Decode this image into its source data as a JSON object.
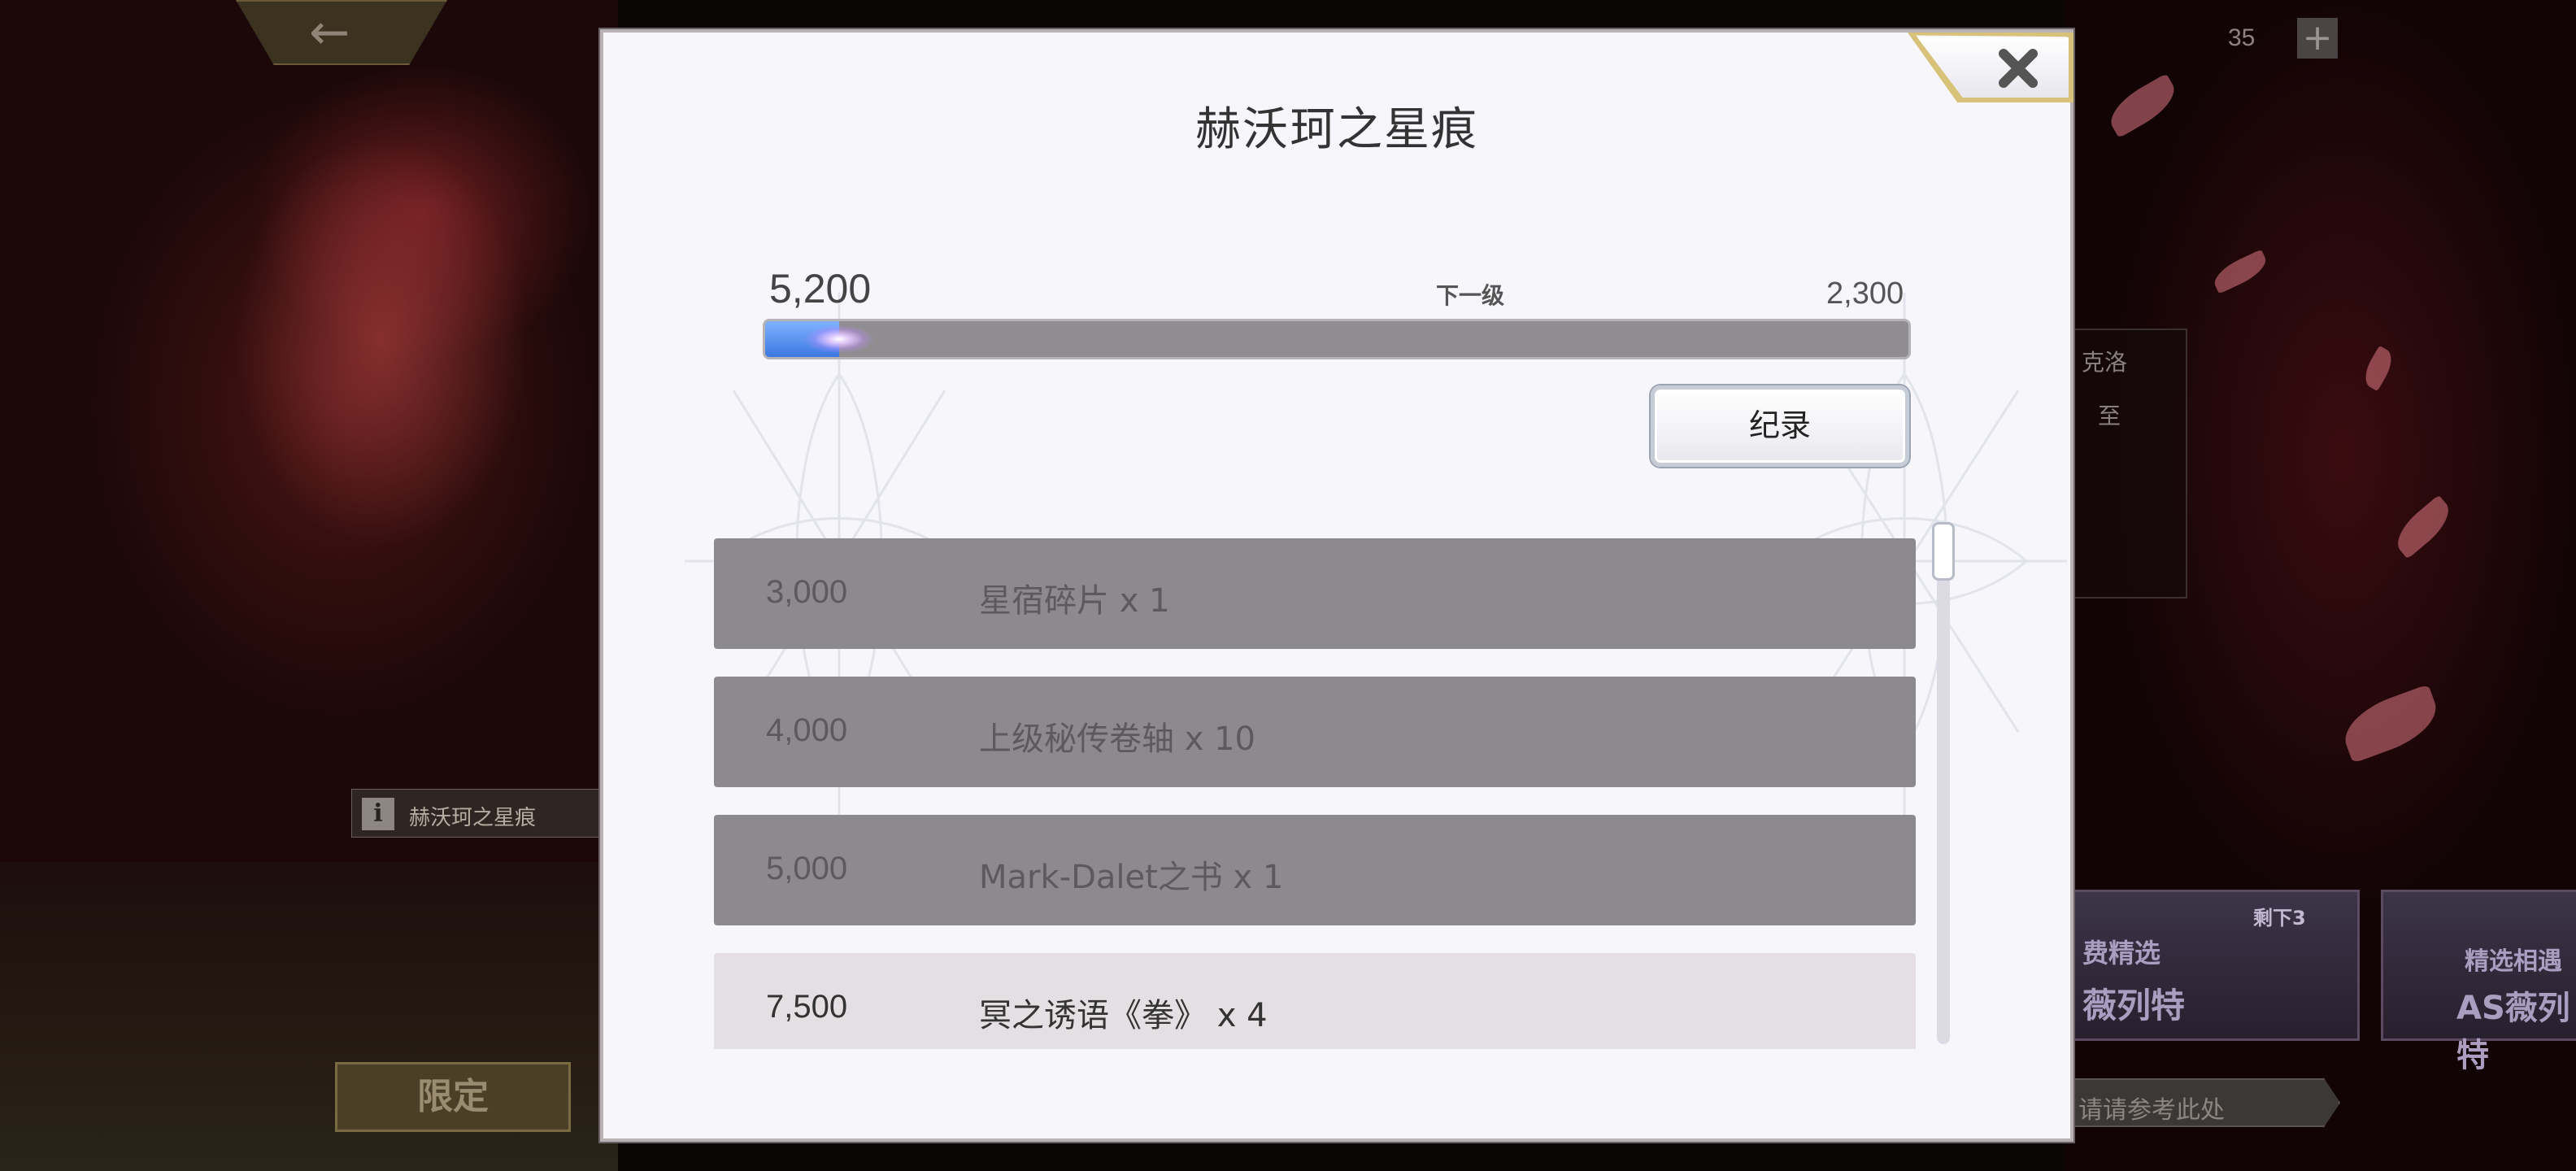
{
  "background": {
    "info_bar_label": "赫沃珂之星痕",
    "limited_label": "限定",
    "top_right_counter": "35",
    "right_panel_text_1": "克洛",
    "right_panel_text_2": "至",
    "banner_1_tag": "剩下3",
    "banner_1_title": "费精选",
    "banner_1_subtitle": "薇列特",
    "banner_2_title": "精选相遇",
    "banner_2_subtitle": "AS薇列特",
    "bottom_hint": "请请参考此处"
  },
  "dialog": {
    "title": "赫沃珂之星痕",
    "close_icon": "close-icon",
    "progress": {
      "current_value": "5,200",
      "next_label": "下一级",
      "next_value": "2,300",
      "fill_fraction": 0.065
    },
    "record_button_label": "纪录",
    "rewards": [
      {
        "points": "3,000",
        "name": "星宿碎片 x 1",
        "state": "claimed"
      },
      {
        "points": "4,000",
        "name": "上级秘传卷轴 x 10",
        "state": "claimed"
      },
      {
        "points": "5,000",
        "name": "Mark-Dalet之书 x 1",
        "state": "claimed"
      },
      {
        "points": "7,500",
        "name": "冥之诱语《拳》 x 4",
        "state": "unlocked"
      }
    ]
  },
  "colors": {
    "dialog_bg": "#f7f6fb",
    "claimed_row": "#8c8a8e",
    "unlocked_row": "#e4dfe2",
    "progress_fill": "#3c78e0",
    "close_frame_accent": "#d8c27a"
  }
}
